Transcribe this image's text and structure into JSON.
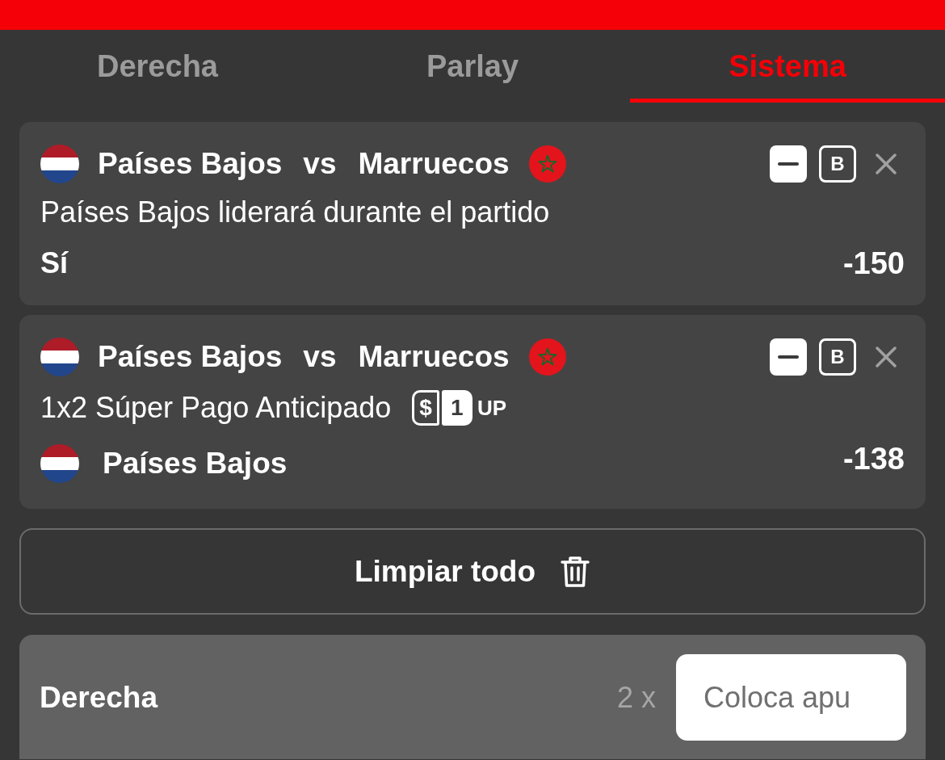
{
  "tabs": [
    {
      "label": "Derecha",
      "selected": false
    },
    {
      "label": "Parlay",
      "selected": false
    },
    {
      "label": "Sistema",
      "selected": true
    }
  ],
  "bets": [
    {
      "home_team": "Países Bajos",
      "separator": "vs",
      "away_team": "Marruecos",
      "b_label": "B",
      "market": "Países Bajos liderará durante el partido",
      "selection": {
        "kind": "plain",
        "label": "Sí"
      },
      "odds": "-150"
    },
    {
      "home_team": "Países Bajos",
      "separator": "vs",
      "away_team": "Marruecos",
      "b_label": "B",
      "market": "1x2 Súper Pago Anticipado",
      "promo_badge": {
        "symbol": "$",
        "number": "1",
        "label": "UP"
      },
      "selection": {
        "kind": "team",
        "label": "Países Bajos"
      },
      "odds": "-138"
    }
  ],
  "clear_button": {
    "label": "Limpiar todo"
  },
  "stake_row": {
    "label": "Derecha",
    "multiplier": "2 x",
    "placeholder": "Coloca apu"
  }
}
